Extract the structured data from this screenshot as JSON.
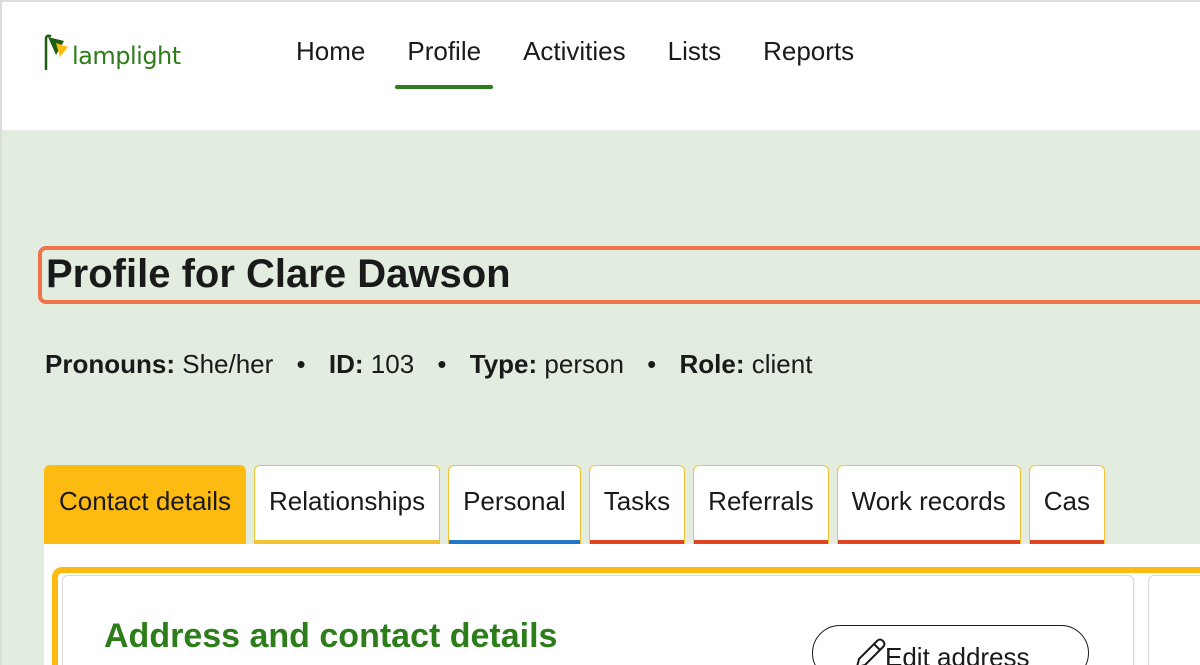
{
  "app": {
    "logo_text": "lamplight"
  },
  "nav": {
    "items": [
      {
        "label": "Home",
        "active": false
      },
      {
        "label": "Profile",
        "active": true
      },
      {
        "label": "Activities",
        "active": false
      },
      {
        "label": "Lists",
        "active": false
      },
      {
        "label": "Reports",
        "active": false
      }
    ]
  },
  "profile": {
    "title_prefix": "Profile for",
    "name": "Clare Dawson",
    "meta": {
      "pronouns_label": "Pronouns:",
      "pronouns": "She/her",
      "id_label": "ID:",
      "id": "103",
      "type_label": "Type:",
      "type": "person",
      "role_label": "Role:",
      "role": "client",
      "separator": "•"
    }
  },
  "tabs": [
    {
      "label": "Contact details",
      "active": true,
      "color": "#fdbb12"
    },
    {
      "label": "Relationships",
      "active": false,
      "color": "#f2c232"
    },
    {
      "label": "Personal",
      "active": false,
      "color": "#1f78c8"
    },
    {
      "label": "Tasks",
      "active": false,
      "color": "#e0461f"
    },
    {
      "label": "Referrals",
      "active": false,
      "color": "#e0461f"
    },
    {
      "label": "Work records",
      "active": false,
      "color": "#e0461f"
    },
    {
      "label": "Cas",
      "active": false,
      "color": "#e0461f"
    }
  ],
  "section": {
    "title": "Address and contact details",
    "edit_button": "Edit address"
  },
  "colors": {
    "brand_green": "#2e7d1b",
    "highlight": "#f0744a",
    "tab_active": "#fdbb12",
    "background": "#e2ede0"
  }
}
